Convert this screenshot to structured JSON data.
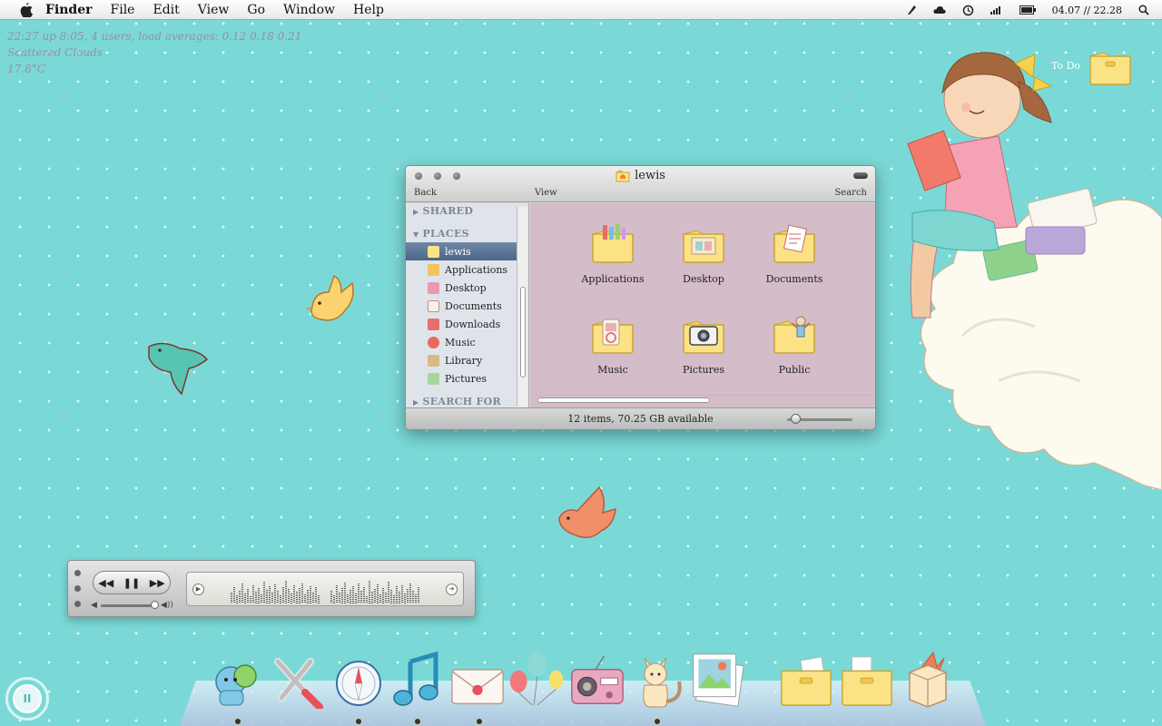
{
  "menubar": {
    "app_name": "Finder",
    "menus": [
      "File",
      "Edit",
      "View",
      "Go",
      "Window",
      "Help"
    ],
    "clock": "04.07 // 22.28"
  },
  "geektool": {
    "uptime": "22:27  up  8:05, 4 users, load averages: 0.12 0.18 0.21",
    "weather": "Scattered Clouds",
    "temperature": "17.8°C"
  },
  "desktop": {
    "todo_label": "To Do"
  },
  "finder": {
    "title": "lewis",
    "toolbar": {
      "back": "Back",
      "view": "View",
      "search": "Search"
    },
    "sidebar": {
      "shared_header": "SHARED",
      "places_header": "PLACES",
      "search_header": "SEARCH FOR",
      "items": [
        {
          "label": "lewis",
          "icon": "home-folder-icon",
          "selected": true
        },
        {
          "label": "Applications",
          "icon": "applications-icon"
        },
        {
          "label": "Desktop",
          "icon": "desktop-icon"
        },
        {
          "label": "Documents",
          "icon": "documents-icon"
        },
        {
          "label": "Downloads",
          "icon": "downloads-icon"
        },
        {
          "label": "Music",
          "icon": "music-icon"
        },
        {
          "label": "Library",
          "icon": "library-icon"
        },
        {
          "label": "Pictures",
          "icon": "pictures-icon"
        }
      ]
    },
    "folders": [
      {
        "label": "Applications"
      },
      {
        "label": "Desktop"
      },
      {
        "label": "Documents"
      },
      {
        "label": "Music"
      },
      {
        "label": "Pictures"
      },
      {
        "label": "Public"
      }
    ],
    "status": "12 items, 70.25 GB available"
  },
  "player": {
    "prev_symbol": "◀◀",
    "pause_symbol": "❚❚",
    "next_symbol": "▶▶",
    "volume_low": "◀",
    "volume_high": "◀))",
    "volume_level": 0.95
  },
  "dock": {
    "items": [
      "Adium",
      "Utilities",
      "Safari",
      "iTunes",
      "Mail",
      "Balloons",
      "Radio",
      "Cat",
      "iPhoto",
      "Folder",
      "Folder",
      "Trash"
    ],
    "pause_symbol": "II"
  },
  "colors": {
    "desktop": "#7ad9d6",
    "finder_content": "#d5bcc9",
    "sidebar": "#dfe4ea",
    "selection": "#5a739a"
  }
}
